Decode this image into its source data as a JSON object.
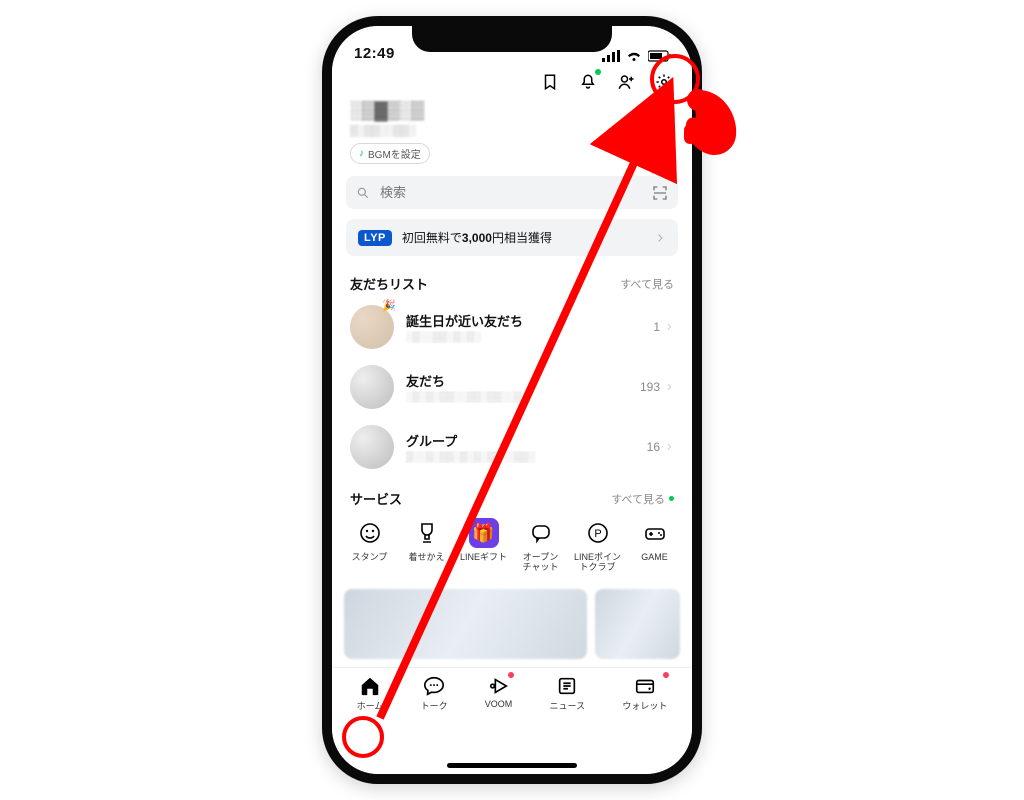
{
  "statusbar": {
    "time": "12:49"
  },
  "header": {},
  "profile": {
    "name": "░▒▓▒░▒",
    "subtitle": "▒░▒▒░░▒▒░",
    "bgm_label": "BGMを設定"
  },
  "search": {
    "placeholder": "検索"
  },
  "promo": {
    "badge": "LYP",
    "text_prefix": "初回無料で",
    "text_bold": "3,000",
    "text_suffix": "円相当獲得"
  },
  "friends": {
    "title": "友だちリスト",
    "see_all": "すべて見る",
    "items": [
      {
        "title": "誕生日が近い友だち",
        "sub": "░▒░░▒▒░▒░▒░",
        "count": "1"
      },
      {
        "title": "友だち",
        "sub": "░▒░▒░▒▒░░▒▒░▒▒░░▒",
        "count": "193"
      },
      {
        "title": "グループ",
        "sub": "▒░░▒░▒▒░▒░▒░▒▒░░▒▒░",
        "count": "16"
      }
    ]
  },
  "services": {
    "title": "サービス",
    "see_all": "すべて見る",
    "items": [
      {
        "label": "スタンプ"
      },
      {
        "label": "着せかえ"
      },
      {
        "label": "LINEギフト"
      },
      {
        "label": "オープン\nチャット"
      },
      {
        "label": "LINEポイン\nトクラブ"
      },
      {
        "label": "GAME"
      }
    ]
  },
  "bottom": {
    "tabs": [
      {
        "label": "ホーム"
      },
      {
        "label": "トーク"
      },
      {
        "label": "VOOM"
      },
      {
        "label": "ニュース"
      },
      {
        "label": "ウォレット"
      }
    ]
  }
}
